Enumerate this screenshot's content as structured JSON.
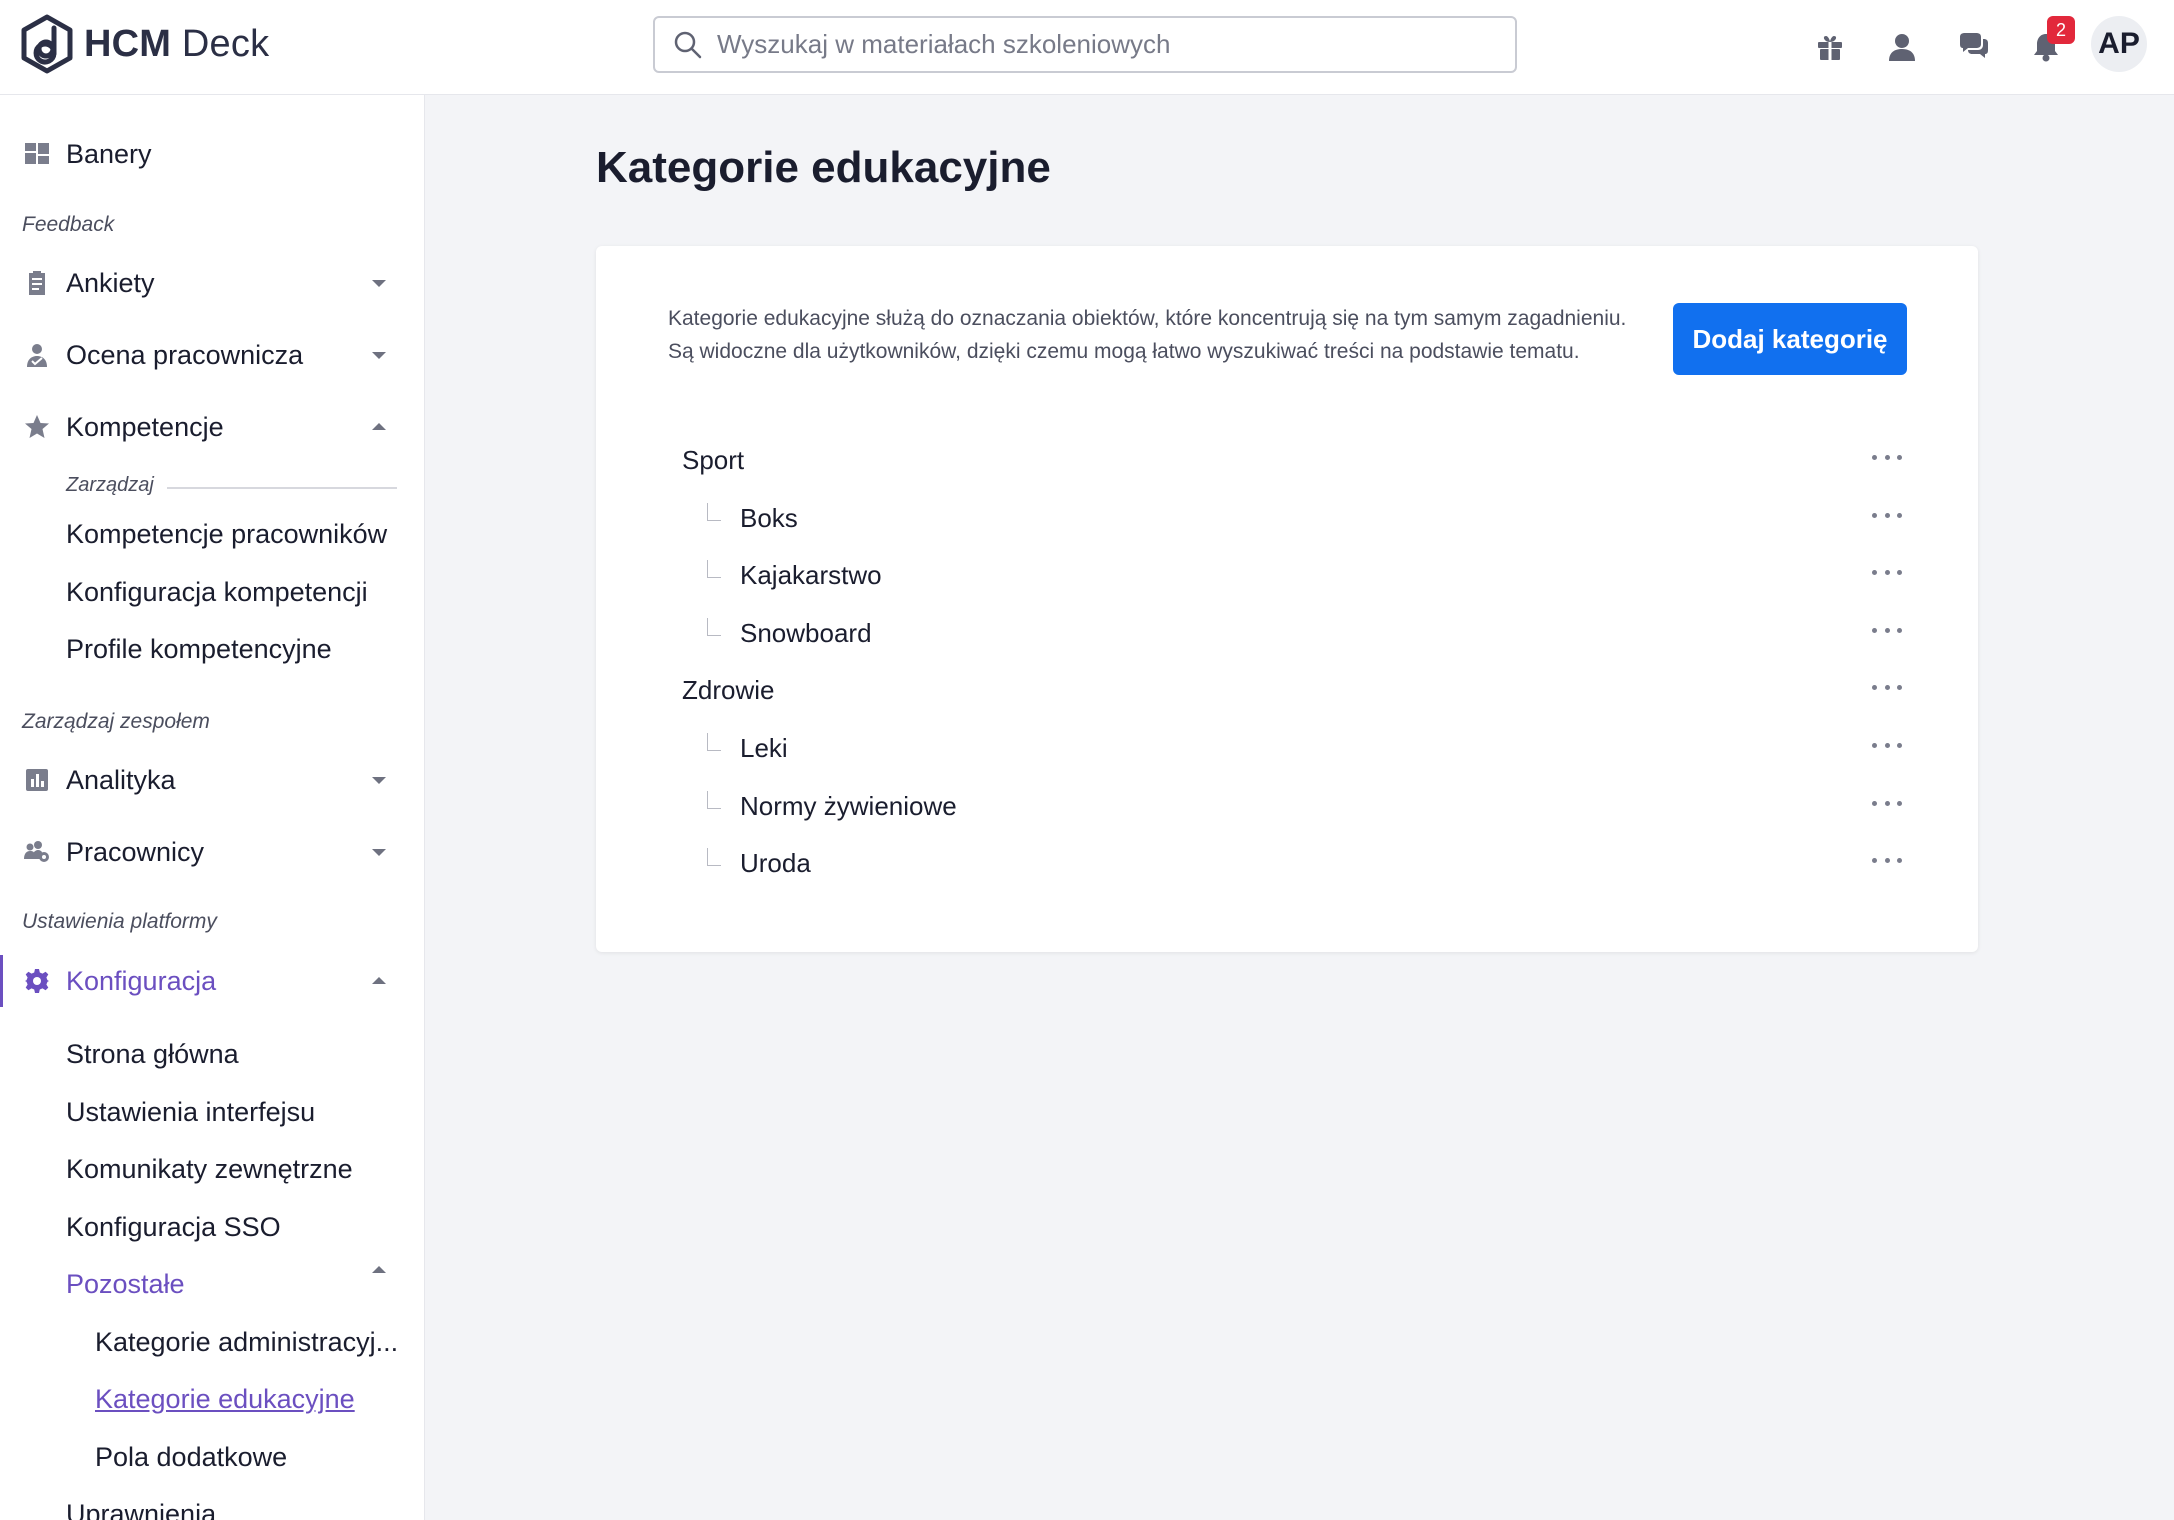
{
  "app": {
    "logo_bold": "HCM",
    "logo_rest": " Deck"
  },
  "search": {
    "placeholder": "Wyszukaj w materiałach szkoleniowych"
  },
  "topbar": {
    "notifications_count": "2",
    "avatar_initials": "AP"
  },
  "sidebar": {
    "banery": "Banery",
    "section_feedback": "Feedback",
    "ankiety": "Ankiety",
    "ocena": "Ocena pracownicza",
    "kompetencje": "Kompetencje",
    "zarzadzaj": "Zarządzaj",
    "kompetencje_pracownikow": "Kompetencje pracowników",
    "konfiguracja_kompetencji": "Konfiguracja kompetencji",
    "profile_kompetencyjne": "Profile kompetencyjne",
    "section_zespol": "Zarządzaj zespołem",
    "analityka": "Analityka",
    "pracownicy": "Pracownicy",
    "section_platforma": "Ustawienia platformy",
    "konfiguracja": "Konfiguracja",
    "strona_glowna": "Strona główna",
    "ustawienia_interfejsu": "Ustawienia interfejsu",
    "komunikaty": "Komunikaty zewnętrzne",
    "sso": "Konfiguracja SSO",
    "pozostale": "Pozostałe",
    "kategorie_admin": "Kategorie administracyj...",
    "kategorie_edu": "Kategorie edukacyjne",
    "pola_dodatkowe": "Pola dodatkowe",
    "uprawnienia": "Uprawnienia"
  },
  "main": {
    "title": "Kategorie edukacyjne",
    "description_line1": "Kategorie edukacyjne służą do oznaczania obiektów, które koncentrują się na tym samym zagadnieniu.",
    "description_line2": "Są widoczne dla użytkowników, dzięki czemu mogą łatwo wyszukiwać treści na podstawie tematu.",
    "add_button": "Dodaj kategorię",
    "categories": [
      {
        "name": "Sport",
        "level": 0
      },
      {
        "name": "Boks",
        "level": 1
      },
      {
        "name": "Kajakarstwo",
        "level": 1
      },
      {
        "name": "Snowboard",
        "level": 1
      },
      {
        "name": "Zdrowie",
        "level": 0
      },
      {
        "name": "Leki",
        "level": 1
      },
      {
        "name": "Normy żywieniowe",
        "level": 1
      },
      {
        "name": "Uroda",
        "level": 1
      }
    ]
  }
}
